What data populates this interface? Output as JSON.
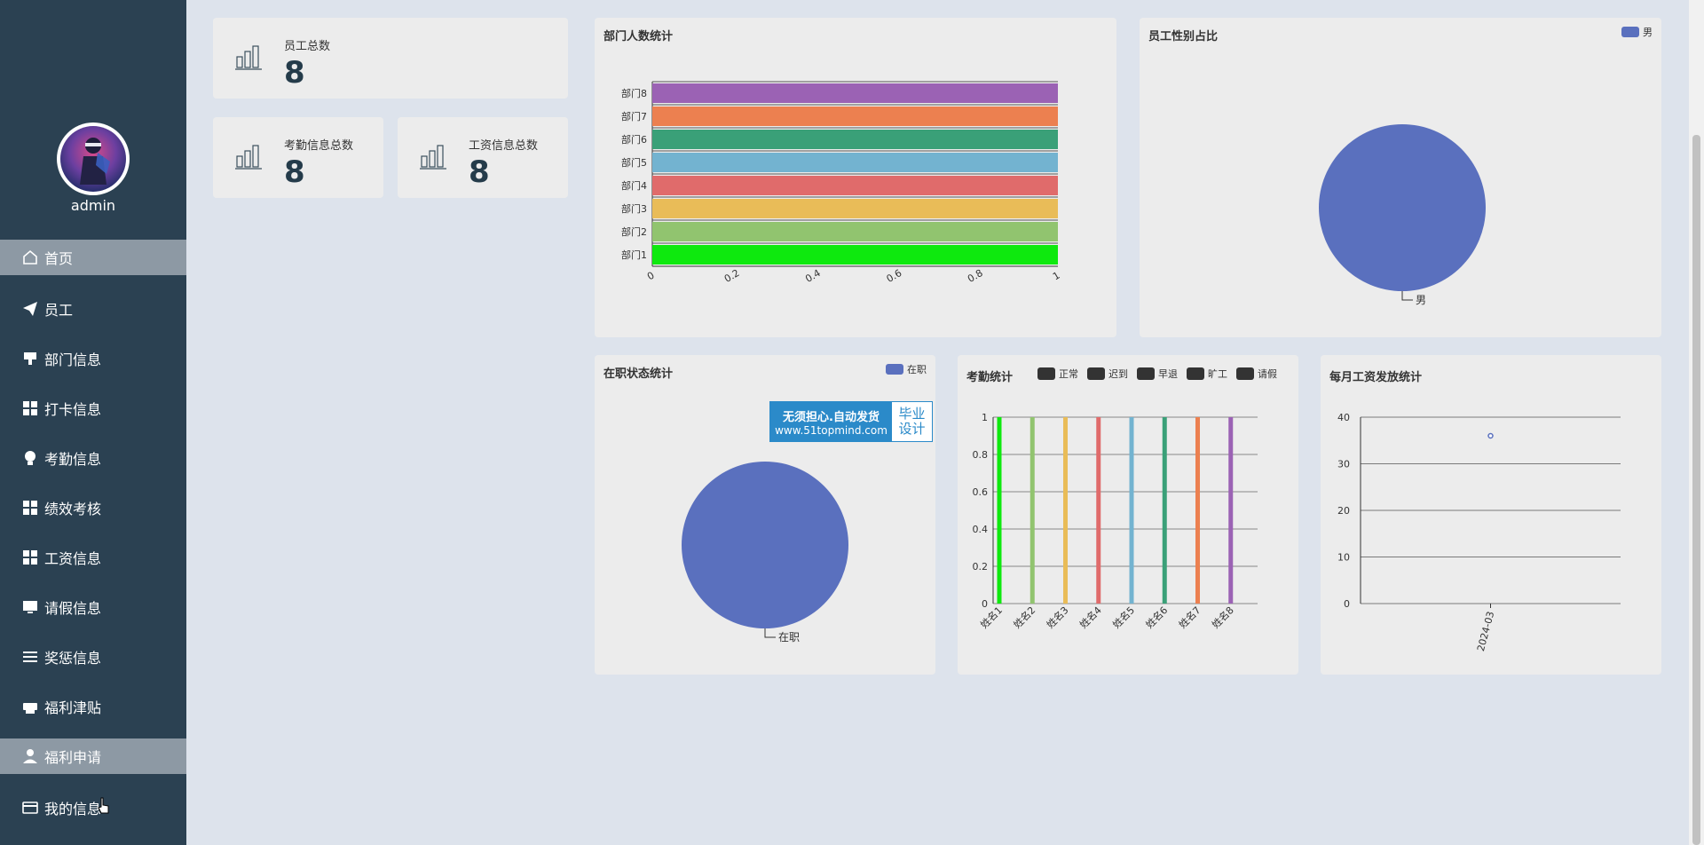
{
  "user": {
    "name": "admin"
  },
  "menu": [
    {
      "label": "首页",
      "icon": "home-icon",
      "active": true
    },
    {
      "label": "员工",
      "icon": "paper-plane-icon"
    },
    {
      "label": "部门信息",
      "icon": "stamp-icon"
    },
    {
      "label": "打卡信息",
      "icon": "grid-icon"
    },
    {
      "label": "考勤信息",
      "icon": "bulb-icon"
    },
    {
      "label": "绩效考核",
      "icon": "grid-icon"
    },
    {
      "label": "工资信息",
      "icon": "grid-icon"
    },
    {
      "label": "请假信息",
      "icon": "monitor-icon"
    },
    {
      "label": "奖惩信息",
      "icon": "list-icon"
    },
    {
      "label": "福利津贴",
      "icon": "printer-icon"
    },
    {
      "label": "福利申请",
      "icon": "user-icon",
      "active": true
    },
    {
      "label": "我的信息",
      "icon": "card-icon"
    }
  ],
  "stats": {
    "employees": {
      "label": "员工总数",
      "value": "8"
    },
    "attendance": {
      "label": "考勤信息总数",
      "value": "8"
    },
    "salary": {
      "label": "工资信息总数",
      "value": "8"
    }
  },
  "charts": {
    "dept": {
      "title": "部门人数统计",
      "type": "bar",
      "orientation": "horizontal",
      "categories": [
        "部门1",
        "部门2",
        "部门3",
        "部门4",
        "部门5",
        "部门6",
        "部门7",
        "部门8"
      ],
      "values": [
        1,
        1,
        1,
        1,
        1,
        1,
        1,
        1
      ],
      "colors": [
        "#0ee90e",
        "#91c46f",
        "#e9bc58",
        "#e06b6b",
        "#73b3d0",
        "#3aa078",
        "#ec8050",
        "#9b62b4"
      ],
      "xticks": [
        "0",
        "0.2",
        "0.4",
        "0.6",
        "0.8",
        "1"
      ],
      "xlim": [
        0,
        1
      ]
    },
    "gender": {
      "title": "员工性别占比",
      "type": "pie",
      "legend": [
        "男"
      ],
      "slices": [
        {
          "name": "男",
          "value": 8
        }
      ],
      "color": "#5a70be"
    },
    "status": {
      "title": "在职状态统计",
      "type": "pie",
      "legend": [
        "在职"
      ],
      "slices": [
        {
          "name": "在职",
          "value": 8
        }
      ],
      "color": "#5a70be"
    },
    "attendance": {
      "title": "考勤统计",
      "type": "bar",
      "legend": [
        "正常",
        "迟到",
        "早退",
        "旷工",
        "请假"
      ],
      "categories": [
        "姓名1",
        "姓名2",
        "姓名3",
        "姓名4",
        "姓名5",
        "姓名6",
        "姓名7",
        "姓名8"
      ],
      "values": [
        1,
        1,
        1,
        1,
        1,
        1,
        1,
        1
      ],
      "colors": [
        "#0ee90e",
        "#91c46f",
        "#e9bc58",
        "#e06b6b",
        "#73b3d0",
        "#3aa078",
        "#ec8050",
        "#9b62b4"
      ],
      "yticks": [
        "0",
        "0.2",
        "0.4",
        "0.6",
        "0.8",
        "1"
      ],
      "ylim": [
        0,
        1
      ]
    },
    "salary": {
      "title": "每月工资发放统计",
      "type": "line",
      "categories": [
        "2024-03"
      ],
      "values": [
        36
      ],
      "yticks": [
        "0",
        "10",
        "20",
        "30",
        "40"
      ],
      "ylim": [
        0,
        40
      ],
      "color": "#5a70be"
    }
  },
  "watermark": {
    "line1": "无须担心.自动发货",
    "line2": "www.51topmind.com",
    "right": [
      "毕业",
      "设计"
    ]
  }
}
